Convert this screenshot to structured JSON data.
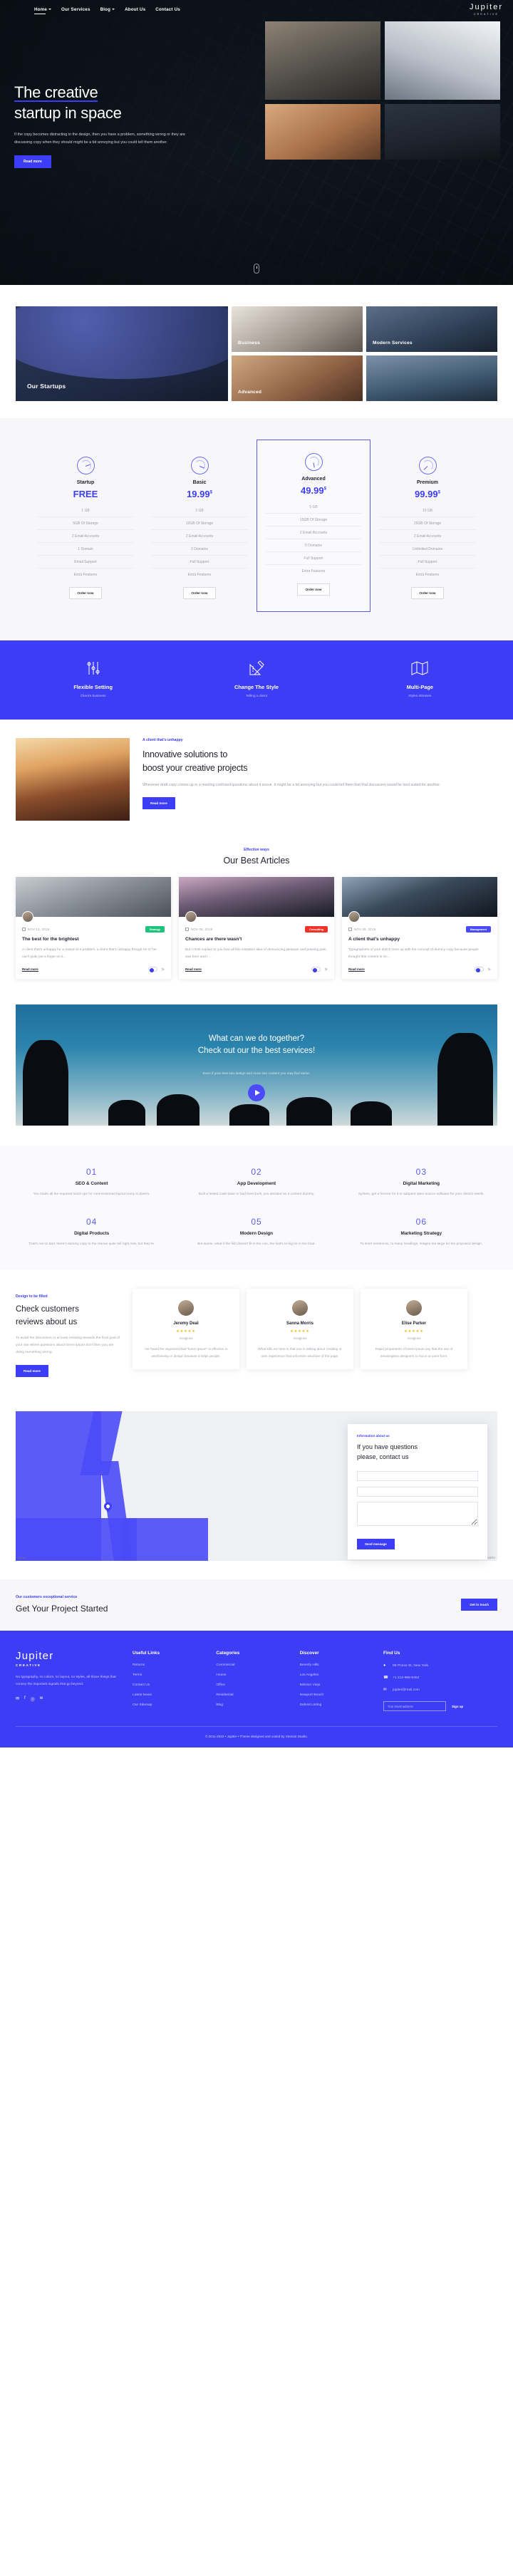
{
  "nav": {
    "links": [
      {
        "label": "Home",
        "caret": true,
        "active": true
      },
      {
        "label": "Our Services",
        "caret": false,
        "active": false
      },
      {
        "label": "Blog",
        "caret": true,
        "active": false
      },
      {
        "label": "About Us",
        "caret": false,
        "active": false
      },
      {
        "label": "Contact Us",
        "caret": false,
        "active": false
      }
    ],
    "brand": "Jupiter",
    "brand_sub": "CREATIVE"
  },
  "hero": {
    "title_line1": "The creative",
    "title_line2": "startup in space",
    "paragraph": "If the copy becomes distracting in the design, then you have a problem, something wrong or they are discussing copy when they should might be a bit annoying but you could tell them another.",
    "cta": "Read more",
    "tiles": [
      "office-meeting",
      "architecture-stairs",
      "team-collaboration",
      "workspace-desks"
    ]
  },
  "categories": {
    "items": [
      {
        "label": "Our Startups",
        "key": "our-startups"
      },
      {
        "label": "Business",
        "key": "business"
      },
      {
        "label": "Modern Services",
        "key": "modern-services"
      },
      {
        "label": "Advanced",
        "key": "advanced"
      }
    ]
  },
  "pricing": {
    "plans": [
      {
        "name": "Startup",
        "price": "FREE",
        "currency": "",
        "rows": [
          "1 GB",
          "5GB Of Storage",
          "2 Email Accounts",
          "1 Domain",
          "Email Support",
          "Extra Features"
        ],
        "button": "Order now",
        "featured": false
      },
      {
        "name": "Basic",
        "price": "19.99",
        "currency": "$",
        "rows": [
          "2 GB",
          "10GB Of Storage",
          "2 Email Accounts",
          "2 Domains",
          "Full Support",
          "Extra Features"
        ],
        "button": "Order now",
        "featured": false
      },
      {
        "name": "Advanced",
        "price": "49.99",
        "currency": "$",
        "rows": [
          "5 GB",
          "15GB Of Storage",
          "2 Email Accounts",
          "5 Domains",
          "Full Support",
          "Extra Features"
        ],
        "button": "Order now",
        "featured": true
      },
      {
        "name": "Premium",
        "price": "99.99",
        "currency": "$",
        "rows": [
          "10 GB",
          "25GB Of Storage",
          "2 Email Accounts",
          "Unlimited Domains",
          "Full Support",
          "Extra Features"
        ],
        "button": "Order now",
        "featured": false
      }
    ]
  },
  "features": {
    "items": [
      {
        "title": "Flexible Setting",
        "sub": "Client's business",
        "icon": "sliders-icon"
      },
      {
        "title": "Change The Style",
        "sub": "Telling a client",
        "icon": "ruler-pencil-icon"
      },
      {
        "title": "Multi-Page",
        "sub": "Styles stresses",
        "icon": "folded-map-icon"
      }
    ]
  },
  "innovative": {
    "eyebrow": "A client that's unhappy",
    "title_line1": "Innovative solutions to",
    "title_line2": "boost your creative projects",
    "paragraph": "Whenever draft copy comes up in a meeting confused questions about it ensue. It might be a bit annoying but you could tell them that that discussion would be best suited for another.",
    "cta": "Read more"
  },
  "articles": {
    "eyebrow": "Effective ways",
    "heading": "Our Best Articles",
    "cards": [
      {
        "date": "NOV 13, 2019",
        "badge": "Strategy",
        "badge_color": "#1ec27a",
        "title": "The best for the brightest",
        "excerpt": "A client that's unhappy for a reason is a problem, a client that's unhappy though he or her can't quite put a finger on it...",
        "read": "Read more"
      },
      {
        "date": "NOV 08, 2019",
        "badge": "Consulting",
        "badge_color": "#f0342a",
        "title": "Chances are there wasn't",
        "excerpt": "But I must explain to you how all this mistaken idea of denouncing pleasure and praising pain was born and I ...",
        "read": "Read more"
      },
      {
        "date": "NOV 08, 2019",
        "badge": "Management",
        "badge_color": "#4a4af7",
        "title": "A client that's unhappy",
        "excerpt": "Typographers of yore didn't come up with the concept of dummy copy because people thought that content is inc...",
        "read": "Read more"
      }
    ]
  },
  "video": {
    "title_line1": "What can we do together?",
    "title_line2": "Check out our the best services!",
    "subtitle": "Even if your less into design and more into content you may find some.",
    "play_label": "play-button"
  },
  "services": {
    "items": [
      {
        "num": "01",
        "title": "SEO & Content",
        "text": "You made all the required mock ups for commissioned layout many in doen's."
      },
      {
        "num": "02",
        "title": "App Development",
        "text": "Built a tested code base or had them built, you decided on a content dummy."
      },
      {
        "num": "03",
        "title": "Digital Marketing",
        "text": "System, got a license for it or adapted open source software for your client's needs."
      },
      {
        "num": "04",
        "title": "Digital Products",
        "text": "That's not so bad, there's dummy copy to the rescue quite tell right now, but they're."
      },
      {
        "num": "05",
        "title": "Modern Design",
        "text": "But worse, what if the fish doesn't fit in the can, the foot's to big for in the boat."
      },
      {
        "num": "06",
        "title": "Marketing Strategy",
        "text": "To short sentences, to many headings, images too large for the proposed design."
      }
    ]
  },
  "testimonials": {
    "eyebrow": "Design to be filled",
    "title_line1": "Check customers",
    "title_line2": "reviews about us",
    "paragraph": "To avoid the discussion or at least resisting towards the final goal of your site where questions about lorem ipsum don't then you are doing something wrong.",
    "cta": "Read more",
    "cards": [
      {
        "name": "Jeremy Deal",
        "stars": "★★★★★",
        "role": "Googlous",
        "text": "I've heard the argument that \"lorem ipsum\" is effective in wireframing or design because it helps people."
      },
      {
        "name": "Sanna Morris",
        "stars": "★★★★★",
        "role": "Googlous",
        "text": "What kills me here is that one is talking about creating or user experience that will entire structure of the page."
      },
      {
        "name": "Elise Parker",
        "stars": "★★★★★",
        "role": "Googlous",
        "text": "Rapid proponents of lorem ipsum say that the use of meaningless designers to focus on pure form."
      }
    ]
  },
  "contact": {
    "eyebrow": "Information about us",
    "title_line1": "If you have questions",
    "title_line2": "please, contact us",
    "fields": [
      {
        "name": "name-field",
        "placeholder": ""
      },
      {
        "name": "email-field",
        "placeholder": ""
      }
    ],
    "message_placeholder": "",
    "submit": "Send message",
    "map_credit": "Mapbox",
    "map_terms": "Leaflet | © OpenStreetMap contributors © CARTO"
  },
  "cta_strip": {
    "eyebrow": "Our customers exceptional service",
    "heading": "Get Your Project Started",
    "button": "Get in touch"
  },
  "footer": {
    "logo": "Jupiter",
    "logo_sub": "CREATIVE",
    "desc": "No typography, no colors, no layout, no styles, all those things that convey the important signals that go beyond.",
    "social": [
      "mail-icon",
      "facebook-icon",
      "pinterest-icon",
      "twitter-icon"
    ],
    "columns": [
      {
        "heading": "Useful Links",
        "links": [
          "Returns",
          "Terms",
          "Contact Us",
          "Latest News",
          "Our Sitemap"
        ]
      },
      {
        "heading": "Categories",
        "links": [
          "Commercial",
          "House",
          "Office",
          "Residential",
          "Blog"
        ]
      },
      {
        "heading": "Discover",
        "links": [
          "Beverly Hills",
          "Los Angeles",
          "Mission Viejo",
          "Newport Beach",
          "Submit Listing"
        ]
      }
    ],
    "find_us": {
      "heading": "Find Us",
      "address": "99 Prince St, New York.",
      "phone": "+1 212-966-5452",
      "email": "jupiter@mail.com",
      "email_placeholder": "Your email address",
      "signup": "Sign up"
    },
    "copyright": "© 2011-2022 • Jupiter • Theme designed and coded by Xtemos Studio."
  },
  "colors": {
    "accent": "#3d3df5",
    "accent_light": "#5b5bf0",
    "dark": "#23232f",
    "muted": "#9a9aa8",
    "bg_alt": "#f7f7fa"
  }
}
